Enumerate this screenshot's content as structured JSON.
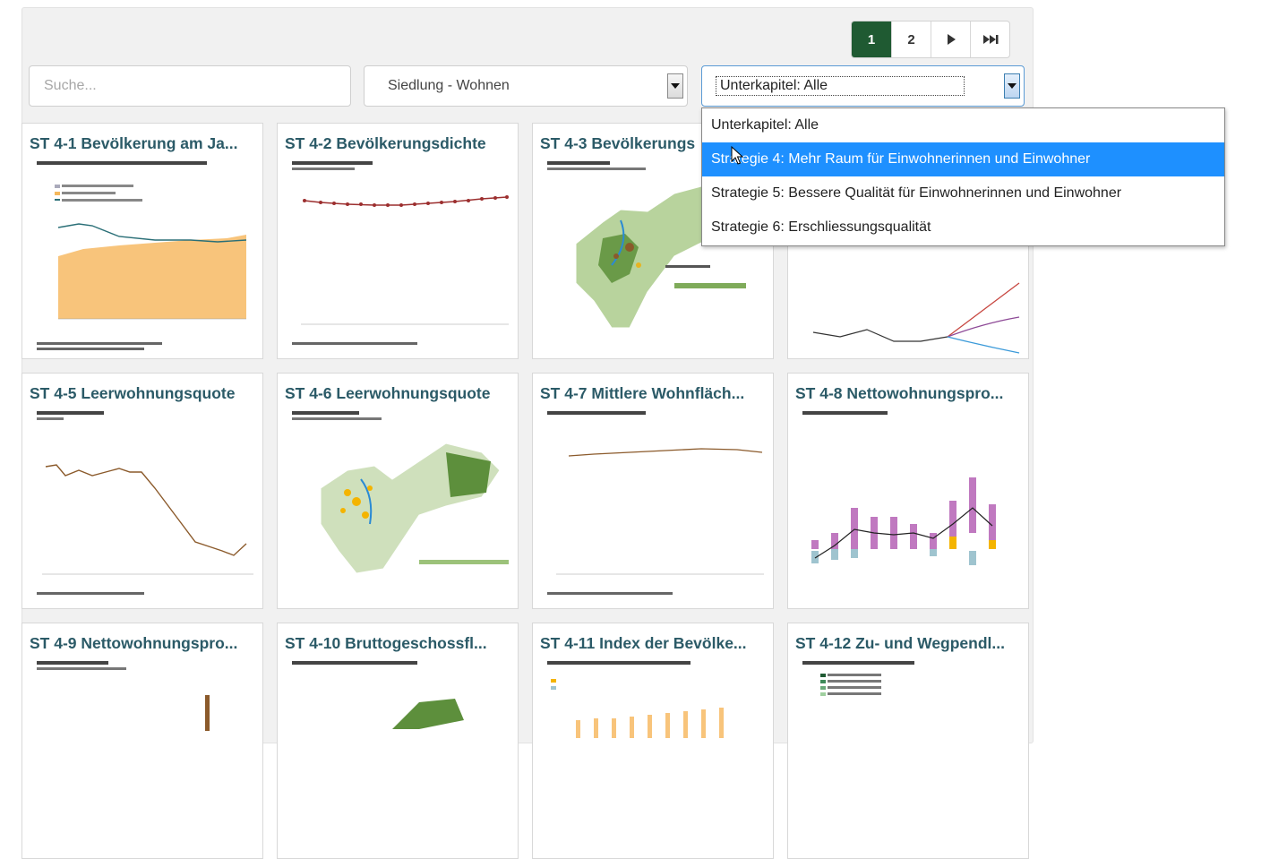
{
  "pagination": {
    "pages": [
      "1",
      "2"
    ],
    "active": "1",
    "next_icon": "play-icon",
    "last_icon": "fast-forward-icon"
  },
  "filters": {
    "search_placeholder": "Suche...",
    "category_value": "Siedlung - Wohnen",
    "subchapter_value": "Unterkapitel: Alle"
  },
  "dropdown": {
    "options": [
      "Unterkapitel: Alle",
      "Strategie 4: Mehr Raum für Einwohnerinnen und Einwohner",
      "Strategie 5: Bessere Qualität für Einwohnerinnen und Einwohner",
      "Strategie 6: Erschliessungsqualität"
    ],
    "highlighted_index": 1
  },
  "cards": [
    {
      "title": "ST 4-1 Bevölkerung am Ja..."
    },
    {
      "title": "ST 4-2 Bevölkerungsdichte"
    },
    {
      "title": "ST 4-3 Bevölkerungs"
    },
    {
      "title": ""
    },
    {
      "title": "ST 4-5 Leerwohnungsquote"
    },
    {
      "title": "ST 4-6 Leerwohnungsquote"
    },
    {
      "title": "ST 4-7 Mittlere Wohnfläch..."
    },
    {
      "title": "ST 4-8 Nettowohnungspro..."
    },
    {
      "title": "ST 4-9 Nettowohnungspro..."
    },
    {
      "title": "ST 4-10 Bruttogeschossfl..."
    },
    {
      "title": "ST 4-11 Index der Bevölke..."
    },
    {
      "title": "ST 4-12 Zu- und Wegpendl..."
    }
  ],
  "colors": {
    "accent_green": "#1f5a32",
    "title_teal": "#2b5a67",
    "highlight_blue": "#1e90ff"
  }
}
